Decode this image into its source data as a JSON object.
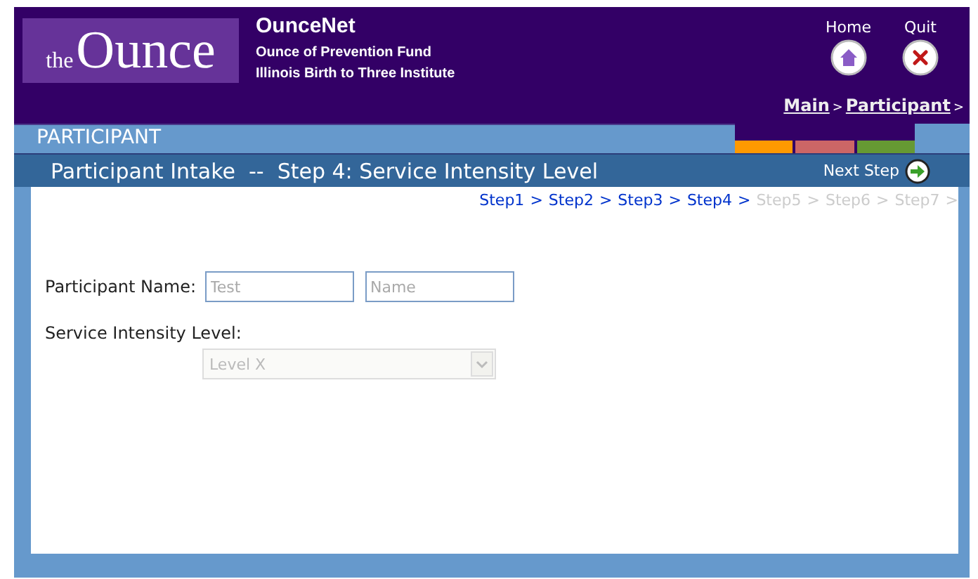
{
  "header": {
    "logo": {
      "small": "the",
      "big": "Ounce"
    },
    "app_name": "OunceNet",
    "org_lines": [
      "Ounce of Prevention Fund",
      "Illinois Birth to Three Institute"
    ],
    "home": {
      "label": "Home"
    },
    "quit": {
      "label": "Quit"
    },
    "breadcrumbs": [
      {
        "label": "Main"
      },
      {
        "label": "Participant"
      }
    ],
    "breadcrumb_separator": ">"
  },
  "section": {
    "title": "PARTICIPANT",
    "color_tabs": [
      {
        "color": "#ff9900"
      },
      {
        "color": "#cc6666"
      },
      {
        "color": "#669933"
      }
    ]
  },
  "page_title": "Participant Intake  --  Step 4: Service Intensity Level",
  "next_step": {
    "label": "Next Step"
  },
  "steps": {
    "separator": ">",
    "items": [
      {
        "label": "Step1",
        "disabled": false
      },
      {
        "label": "Step2",
        "disabled": false
      },
      {
        "label": "Step3",
        "disabled": false
      },
      {
        "label": "Step4",
        "disabled": false
      },
      {
        "label": "Step5",
        "disabled": true
      },
      {
        "label": "Step6",
        "disabled": true
      },
      {
        "label": "Step7",
        "disabled": true
      }
    ]
  },
  "form": {
    "name_label": "Participant Name:",
    "first_name": {
      "value": "Test",
      "disabled": true
    },
    "last_name": {
      "value": "Name",
      "disabled": true
    },
    "level_label": "Service Intensity Level:",
    "level_select": {
      "value": "Level X",
      "disabled": true
    }
  }
}
